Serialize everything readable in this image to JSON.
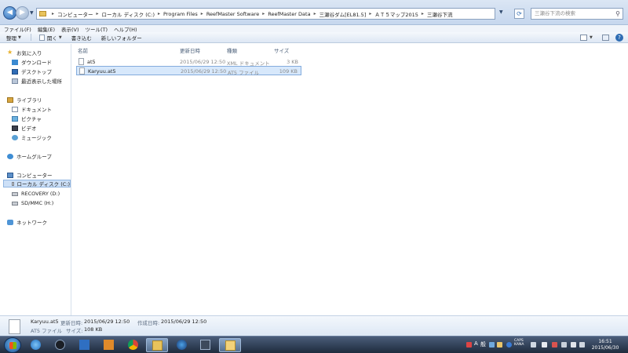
{
  "address": {
    "crumbs": [
      "コンピューター",
      "ローカル ディスク (C:)",
      "Program Files",
      "ReefMaster Software",
      "ReefMaster Data",
      "三瀬谷ダム[EL81.5]",
      "ＡＴ５マップ2015",
      "三瀬谷下流"
    ],
    "separator": "▸",
    "search_placeholder": "三瀬谷下流の検索"
  },
  "menu": {
    "items": [
      "ファイル(F)",
      "編集(E)",
      "表示(V)",
      "ツール(T)",
      "ヘルプ(H)"
    ]
  },
  "command": {
    "organize": "整理",
    "open": "開く",
    "burn": "書き込む",
    "new_folder": "新しいフォルダー"
  },
  "nav": {
    "favorites": "お気に入り",
    "downloads": "ダウンロード",
    "desktop": "デスクトップ",
    "recent": "最近表示した場所",
    "libraries": "ライブラリ",
    "documents": "ドキュメント",
    "pictures": "ピクチャ",
    "videos": "ビデオ",
    "music": "ミュージック",
    "homegroup": "ホームグループ",
    "computer": "コンピューター",
    "local_disk": "ローカル ディスク (C:)",
    "recovery": "RECOVERY (D:)",
    "sdmmc": "SD/MMC (H:)",
    "network": "ネットワーク"
  },
  "columns": {
    "name": "名前",
    "date": "更新日時",
    "type": "種類",
    "size": "サイズ"
  },
  "files": [
    {
      "name": "at5",
      "date": "2015/06/29 12:50",
      "type": "XML ドキュメント",
      "size": "3 KB"
    },
    {
      "name": "Karyuu.at5",
      "date": "2015/06/29 12:50",
      "type": "AT5 ファイル",
      "size": "109 KB"
    }
  ],
  "details": {
    "filename": "Karyuu.at5",
    "modified_label": "更新日時:",
    "modified_value": "2015/06/29 12:50",
    "created_label": "作成日時:",
    "created_value": "2015/06/29 12:50",
    "type": "AT5 ファイル",
    "size_label": "サイズ:",
    "size_value": "108 KB"
  },
  "taskbar": {
    "time": "16:51",
    "date": "2015/06/30",
    "ime_mode": "A",
    "ime_kanji": "般",
    "ime_caps": "CAPS\nKANA"
  },
  "colors": {
    "selection_bg": "#d7e8fb",
    "selection_border": "#84acdd",
    "taskbar": "#1f2b3d"
  }
}
